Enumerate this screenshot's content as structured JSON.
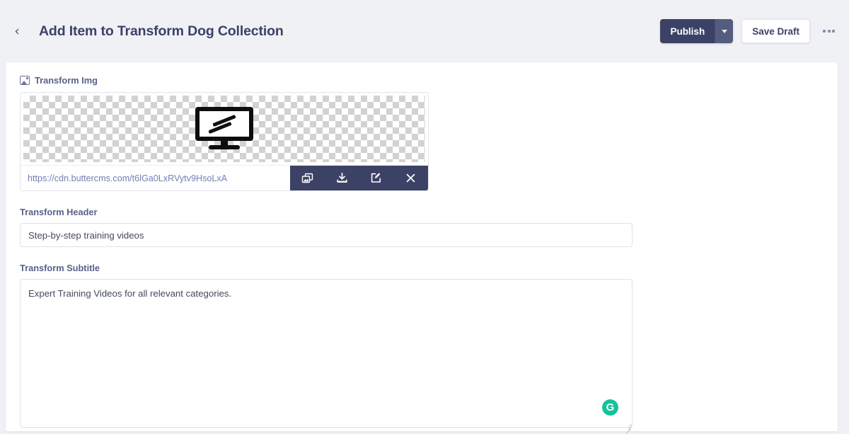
{
  "header": {
    "back_icon": "chevron-left-icon",
    "title": "Add Item to Transform Dog Collection",
    "publish_label": "Publish",
    "publish_caret_icon": "chevron-down-icon",
    "save_draft_label": "Save Draft",
    "more_icon": "ellipsis-icon",
    "publish_color": "#3b4265",
    "publish_caret_color": "#555d7e"
  },
  "form": {
    "image_field": {
      "label": "Transform Img",
      "label_icon": "image-icon",
      "preview_icon": "monitor-icon",
      "url_value": "https://cdn.buttercms.com/t6lGa0LxRVytv9HsoLxA",
      "toolbar": [
        {
          "name": "duplicate-image-icon",
          "title": "Copy"
        },
        {
          "name": "download-icon",
          "title": "Download"
        },
        {
          "name": "edit-icon",
          "title": "Edit"
        },
        {
          "name": "close-icon",
          "title": "Remove"
        }
      ],
      "toolbar_color": "#3b4265"
    },
    "header_field": {
      "label": "Transform Header",
      "value": "Step-by-step training videos",
      "placeholder": ""
    },
    "subtitle_field": {
      "label": "Transform Subtitle",
      "value": "Expert Training Videos for all relevant categories.",
      "placeholder": "",
      "assistant_badge": "G",
      "assistant_color": "#15c39a"
    }
  }
}
